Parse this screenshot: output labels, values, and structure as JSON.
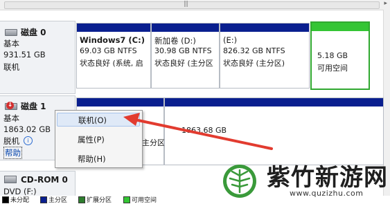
{
  "disk0": {
    "name": "磁盘 0",
    "type": "基本",
    "size": "931.51 GB",
    "status": "联机",
    "partitions": [
      {
        "title": "Windows7  (C:)",
        "size": "69.03 GB NTFS",
        "status": "状态良好 (系统, 启"
      },
      {
        "title": "新加卷  (D:)",
        "size": "30.98 GB NTFS",
        "status": "状态良好 (主分区"
      },
      {
        "title": "(E:)",
        "size": "826.32 GB NTFS",
        "status": "状态良好 (主分区)"
      },
      {
        "title": "",
        "size": "5.18 GB",
        "status": "可用空间"
      }
    ]
  },
  "disk1": {
    "name": "磁盘 1",
    "type": "基本",
    "size": "1863.02 GB",
    "status": "脱机",
    "help_link": "帮助",
    "partition_size": "1863.68 GB",
    "partition_status_fragment": "主分区"
  },
  "context_menu": {
    "items": [
      "联机(O)",
      "属性(P)",
      "帮助(H)"
    ]
  },
  "cdrom": {
    "name": "CD-ROM 0",
    "type": "DVD (F:)"
  },
  "legend": {
    "items": [
      {
        "label": "未分配",
        "color": "#000000"
      },
      {
        "label": "主分区",
        "color": "#0a1f8f"
      },
      {
        "label": "扩展分区",
        "color": "#2e7d2e"
      },
      {
        "label": "可用空间",
        "color": "#34c534"
      }
    ]
  },
  "watermark": {
    "brand": "紫竹新游网",
    "url": "www.quzizhu.com"
  }
}
